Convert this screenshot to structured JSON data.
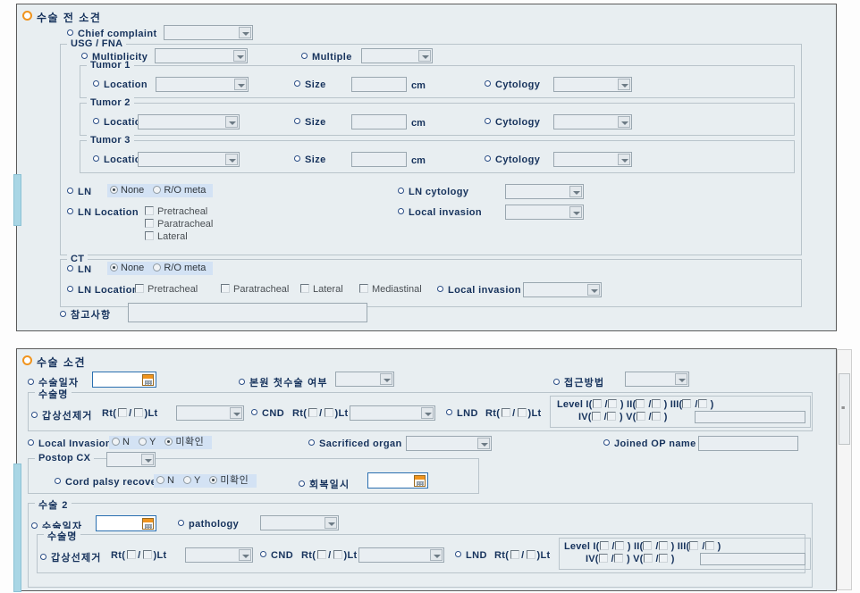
{
  "preop": {
    "title": "수술 전 소견",
    "chief_complaint": {
      "label": "Chief complaint",
      "value": ""
    },
    "usg_fna": {
      "legend": "USG / FNA",
      "multiplicity": {
        "label": "Multiplicity",
        "value": ""
      },
      "multiple": {
        "label": "Multiple",
        "value": ""
      },
      "tumors": [
        {
          "legend": "Tumor 1",
          "location_label": "Location",
          "location_value": "",
          "size_label": "Size",
          "size_value": "",
          "unit": "cm",
          "cytology_label": "Cytology",
          "cytology_value": ""
        },
        {
          "legend": "Tumor 2",
          "location_label": "Location",
          "location_value": "",
          "size_label": "Size",
          "size_value": "",
          "unit": "cm",
          "cytology_label": "Cytology",
          "cytology_value": ""
        },
        {
          "legend": "Tumor 3",
          "location_label": "Location",
          "location_value": "",
          "size_label": "Size",
          "size_value": "",
          "unit": "cm",
          "cytology_label": "Cytology",
          "cytology_value": ""
        }
      ],
      "ln": {
        "label": "LN",
        "options": [
          "None",
          "R/O meta"
        ],
        "selected": "None"
      },
      "ln_cytology": {
        "label": "LN cytology",
        "value": ""
      },
      "ln_location": {
        "label": "LN Location",
        "options": [
          "Pretracheal",
          "Paratracheal",
          "Lateral"
        ],
        "checked": []
      },
      "local_invasion": {
        "label": "Local invasion",
        "value": ""
      }
    },
    "ct": {
      "legend": "CT",
      "ln": {
        "label": "LN",
        "options": [
          "None",
          "R/O meta"
        ],
        "selected": "None"
      },
      "ln_location": {
        "label": "LN Location",
        "options": [
          "Pretracheal",
          "Paratracheal",
          "Lateral",
          "Mediastinal"
        ],
        "checked": []
      },
      "local_invasion": {
        "label": "Local invasion",
        "value": ""
      }
    },
    "remark": {
      "label": "참고사항",
      "value": ""
    }
  },
  "op": {
    "title": "수술 소견",
    "op_date": {
      "label": "수술일자",
      "value": "",
      "icon": "calendar-icon"
    },
    "first_op": {
      "label": "본원 첫수술 여부",
      "value": ""
    },
    "approach": {
      "label": "접근방법",
      "value": ""
    },
    "op_name": {
      "legend": "수술명",
      "thyroidectomy": {
        "label": "갑상선제거",
        "side_prefix": "Rt(",
        "side_sep": "/",
        "side_suffix": ")Lt",
        "value": ""
      },
      "cnd": {
        "label": "CND",
        "side_prefix": "Rt(",
        "side_sep": "/",
        "side_suffix": ")Lt",
        "value": ""
      },
      "lnd": {
        "label": "LND",
        "side_prefix": "Rt(",
        "side_sep": "/",
        "side_suffix": ")Lt"
      },
      "levels_prefix": "Level",
      "levels_row1": [
        "I",
        "II",
        "III"
      ],
      "levels_row2": [
        "IV",
        "V"
      ],
      "level_open": "(",
      "level_sep": "/",
      "level_close": ")",
      "level_note": ""
    },
    "local_invasion": {
      "label": "Local Invasion",
      "options": [
        "N",
        "Y",
        "미확인"
      ],
      "selected": "미확인"
    },
    "sacrificed_organ": {
      "label": "Sacrificed organ",
      "value": ""
    },
    "joined_op_name": {
      "label": "Joined OP name",
      "value": ""
    },
    "postop_cx": {
      "legend": "Postop CX",
      "value": ""
    },
    "cord_palsy_recovery": {
      "label": "Cord palsy recovery",
      "options": [
        "N",
        "Y",
        "미확인"
      ],
      "selected": "미확인"
    },
    "recovery_date": {
      "label": "회복일시",
      "value": "",
      "icon": "calendar-icon"
    },
    "op2": {
      "legend": "수술 2",
      "op_date": {
        "label": "수술일자",
        "value": "",
        "icon": "calendar-icon"
      },
      "pathology": {
        "label": "pathology",
        "value": ""
      },
      "op_name": {
        "legend": "수술명",
        "thyroidectomy": {
          "label": "갑상선제거",
          "side_prefix": "Rt(",
          "side_sep": "/",
          "side_suffix": ")Lt",
          "value": ""
        },
        "cnd": {
          "label": "CND",
          "side_prefix": "Rt(",
          "side_sep": "/",
          "side_suffix": ")Lt",
          "value": ""
        },
        "lnd": {
          "label": "LND",
          "side_prefix": "Rt(",
          "side_sep": "/",
          "side_suffix": ")Lt"
        },
        "levels_prefix": "Level",
        "levels_row1": [
          "I",
          "II",
          "III"
        ],
        "levels_row2": [
          "IV",
          "V"
        ],
        "level_open": "(",
        "level_sep": "/",
        "level_close": ")",
        "level_note": ""
      }
    }
  },
  "colors": {
    "panel_bg": "#e8eef1",
    "label_blue": "#16325c",
    "accent_orange": "#f0941e",
    "radio_highlight": "#d3e2f4",
    "scroll_thumb": "#a9d6e5"
  }
}
